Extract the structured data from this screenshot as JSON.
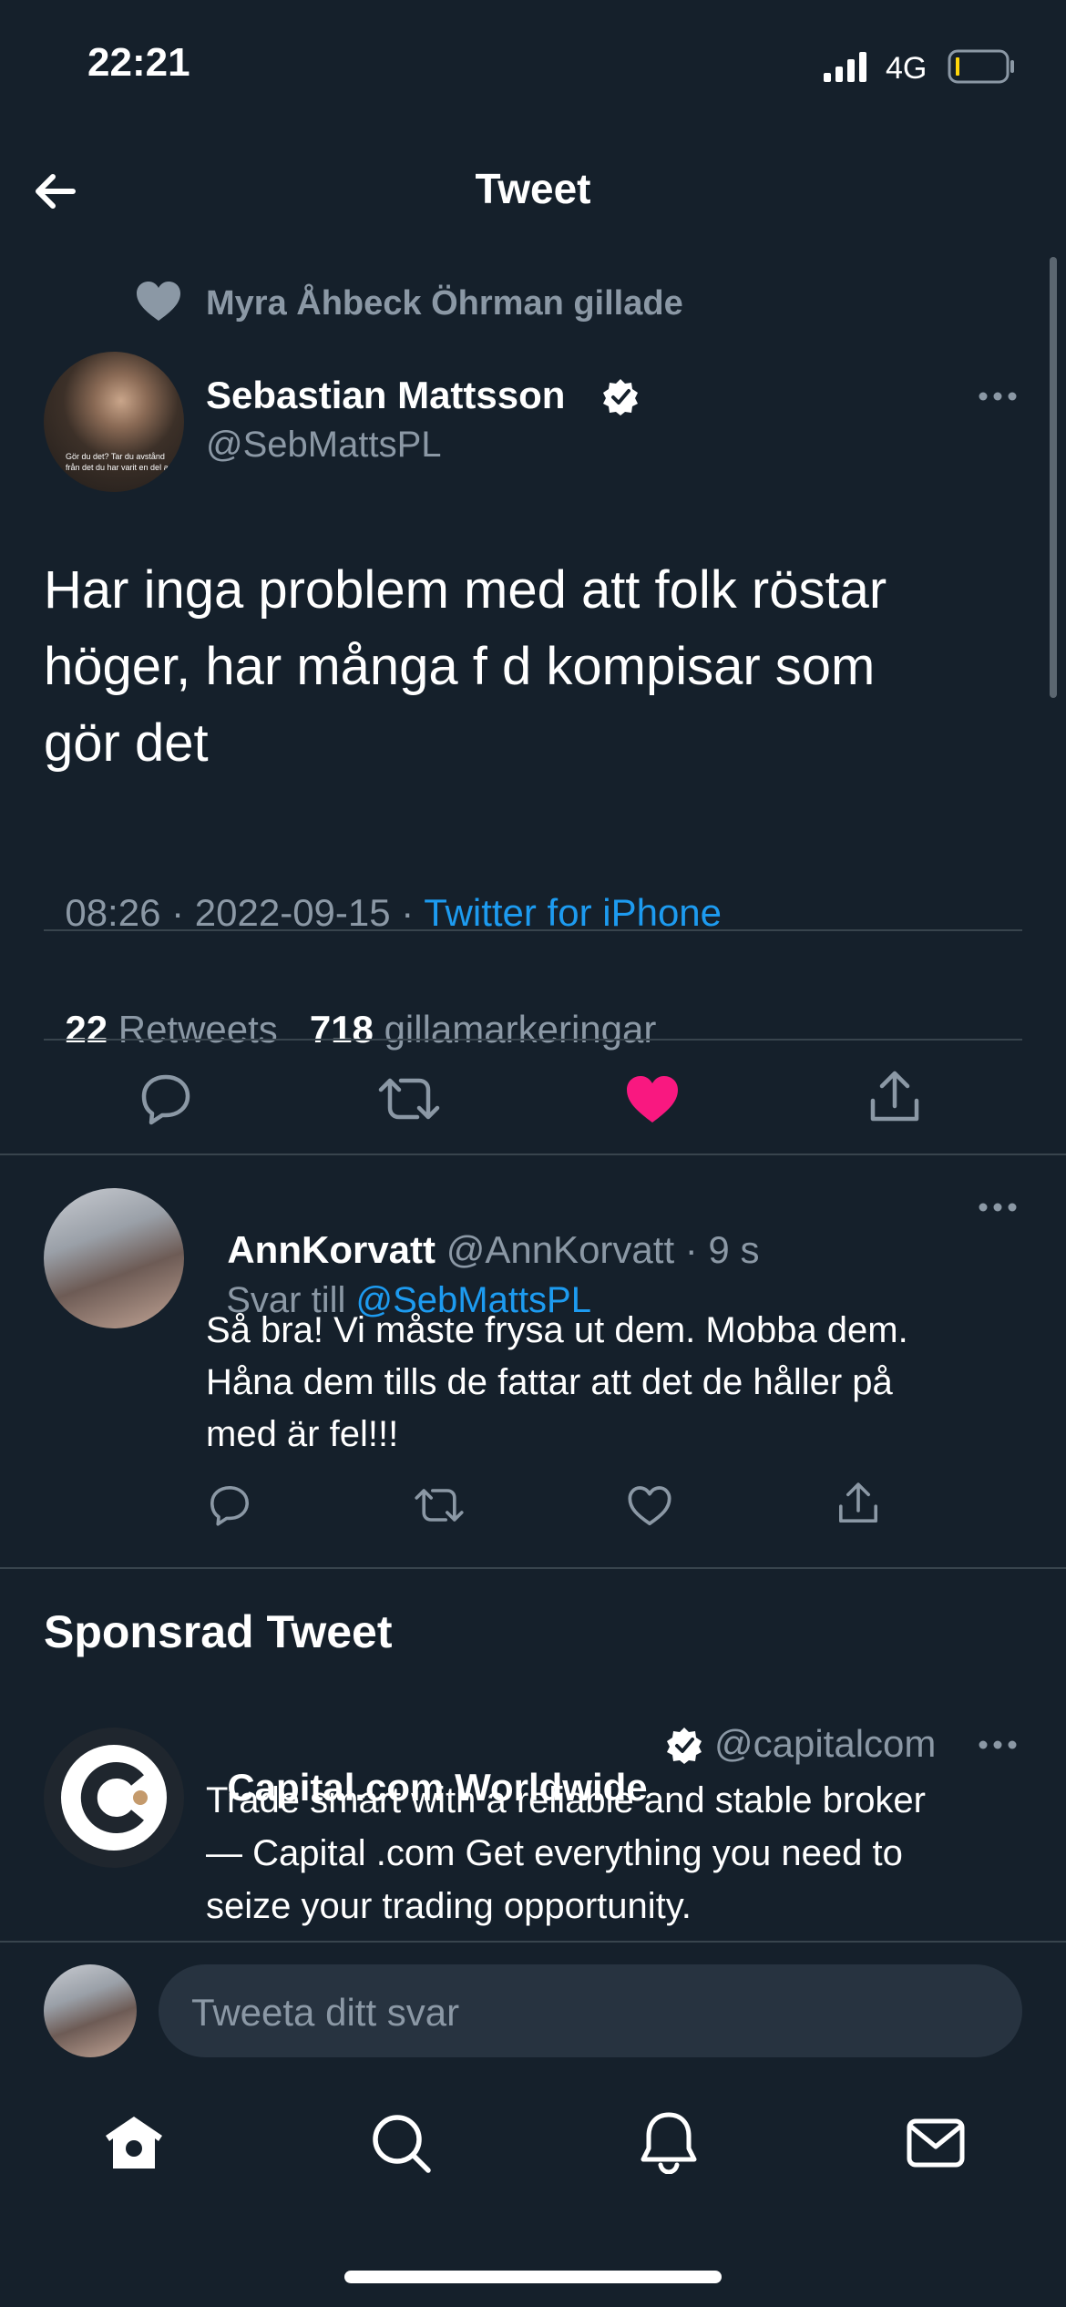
{
  "status_bar": {
    "time": "22:21",
    "network": "4G"
  },
  "header": {
    "title": "Tweet"
  },
  "social_context": {
    "text": "Myra Åhbeck Öhrman gillade"
  },
  "tweet": {
    "author_name": "Sebastian Mattsson",
    "handle": "@SebMattsPL",
    "avatar_caption_1": "Gör du det? Tar du avstånd",
    "avatar_caption_2": "från det du har varit en del av?",
    "text_line_1": "Har inga problem med att folk röstar",
    "text_line_2": "höger, har många f d kompisar som",
    "text_line_3": "gör det",
    "time": "08:26",
    "sep_1": " · ",
    "date": "2022-09-15",
    "sep_2": " · ",
    "source": "Twitter for iPhone",
    "retweets_count": "22",
    "retweets_label": "Retweets",
    "likes_count": "718",
    "likes_label": "gillamarkeringar"
  },
  "reply": {
    "author_name": "AnnKorvatt",
    "handle_meta": "@AnnKorvatt · 9 s",
    "reply_to_prefix": "Svar till ",
    "reply_to_handle": "@SebMattsPL",
    "text_line_1": "Så bra! Vi måste frysa ut dem. Mobba dem.",
    "text_line_2": "Håna dem tills de fattar att det de håller på",
    "text_line_3": "med är fel!!!"
  },
  "sponsored": {
    "section_title": "Sponsrad Tweet",
    "author_name": "Capital.com Worldwide",
    "handle": "@capitalcom",
    "text_line_1": "Trade smart with a reliable and stable broker",
    "text_line_2": "— Capital .com Get everything you need to",
    "text_line_3": "seize your trading opportunity."
  },
  "compose": {
    "placeholder": "Tweeta ditt svar"
  },
  "colors": {
    "background": "#15202b",
    "accent": "#1d9bf0",
    "like": "#f91880",
    "muted": "#8b98a5",
    "divider": "#38444d"
  },
  "icons": {
    "back": "arrow-left-icon",
    "more": "more-horizontal-icon",
    "verified": "verified-badge-icon",
    "reply": "reply-icon",
    "retweet": "retweet-icon",
    "like": "heart-icon",
    "share": "share-icon",
    "home": "home-icon",
    "search": "search-icon",
    "notifications": "bell-icon",
    "messages": "envelope-icon"
  }
}
